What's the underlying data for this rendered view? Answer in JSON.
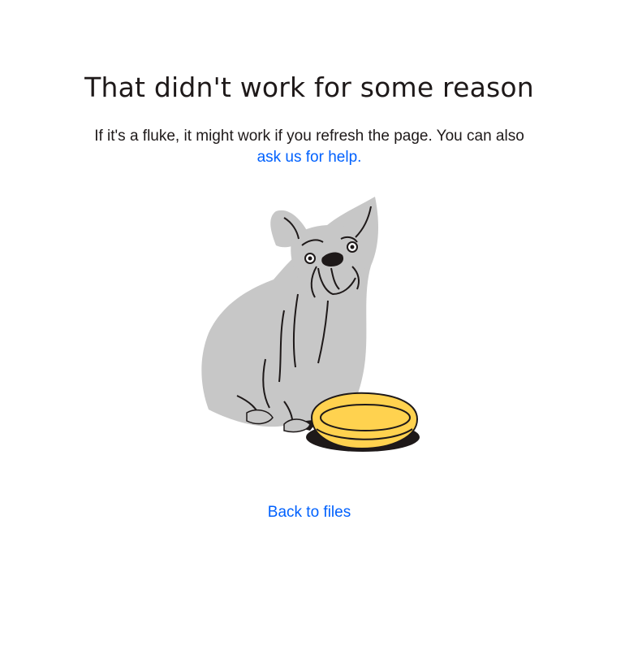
{
  "error": {
    "title": "That didn't work for some reason",
    "message_part1": "If it's a fluke, it might work if you refresh the page. You can also",
    "help_link": "ask us for help.",
    "back_link": "Back to files"
  },
  "illustration": {
    "icon": "sad-bulldog-empty-bowl-icon",
    "colors": {
      "dog": "#c7c7c7",
      "bowl": "#ffd24f",
      "outline": "#1e1919"
    }
  },
  "colors": {
    "link": "#0061fe",
    "text": "#1e1919",
    "background": "#ffffff"
  }
}
